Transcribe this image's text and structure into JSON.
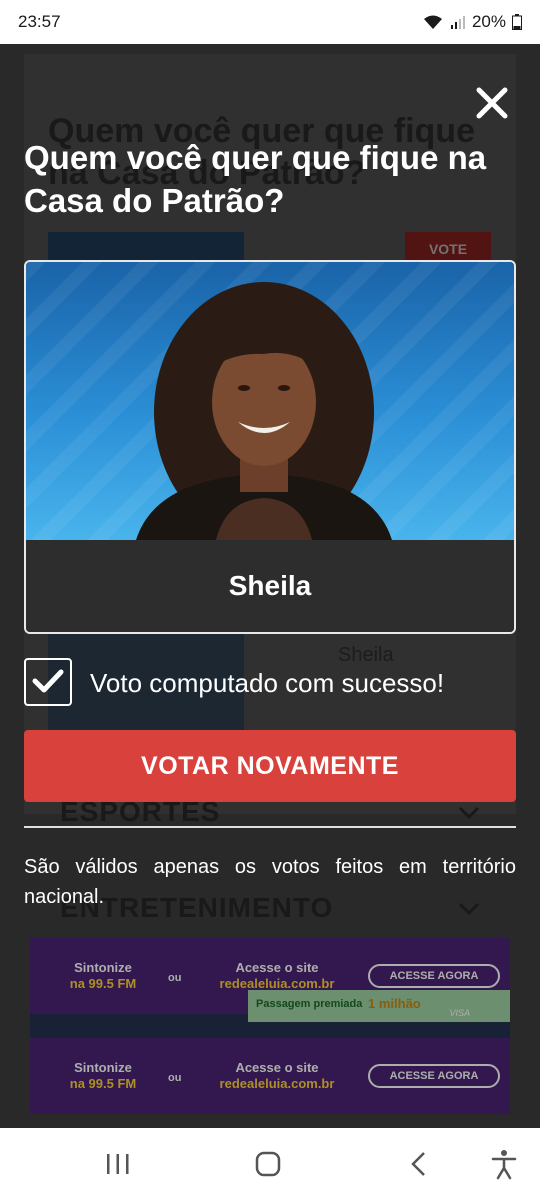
{
  "status": {
    "time": "23:57",
    "battery": "20%"
  },
  "background": {
    "title": "Quem você quer que fique na Casa do Patrão?",
    "vote_label": "VOTE",
    "candidate_name": "Sheila",
    "menu": [
      "ESPORTES",
      "ENTRETENIMENTO"
    ]
  },
  "modal": {
    "title": "Quem você quer que fique na Casa do Patrão?",
    "candidate_name": "Sheila",
    "success_message": "Voto computado com sucesso!",
    "vote_again_label": "VOTAR NOVAMENTE",
    "notice": "São válidos apenas os votos feitos em território nacional."
  },
  "ads": {
    "radio_line1": "Sintonize",
    "radio_line2": "na 99.5 FM",
    "or": "ou",
    "site_line1": "Acesse o site",
    "site_line2": "redealeluia.com.br",
    "button": "ACESSE AGORA",
    "promo_left": "Passagem premiada",
    "promo_right": "1 milhão",
    "card_brand": "VISA"
  },
  "colors": {
    "accent": "#d8413c",
    "ad_purple": "#4b2474",
    "photo_blue": "#2b8fd6"
  },
  "icons": [
    "close-icon",
    "check-icon",
    "wifi-icon",
    "signal-icon",
    "battery-icon",
    "recents-icon",
    "home-icon",
    "back-icon",
    "accessibility-icon",
    "chevron-down-icon"
  ]
}
